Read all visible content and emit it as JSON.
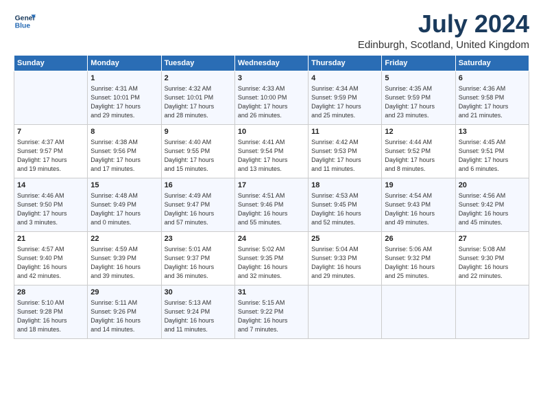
{
  "logo": {
    "line1": "General",
    "line2": "Blue"
  },
  "title": "July 2024",
  "subtitle": "Edinburgh, Scotland, United Kingdom",
  "days": [
    "Sunday",
    "Monday",
    "Tuesday",
    "Wednesday",
    "Thursday",
    "Friday",
    "Saturday"
  ],
  "rows": [
    [
      {
        "num": "",
        "lines": []
      },
      {
        "num": "1",
        "lines": [
          "Sunrise: 4:31 AM",
          "Sunset: 10:01 PM",
          "Daylight: 17 hours",
          "and 29 minutes."
        ]
      },
      {
        "num": "2",
        "lines": [
          "Sunrise: 4:32 AM",
          "Sunset: 10:01 PM",
          "Daylight: 17 hours",
          "and 28 minutes."
        ]
      },
      {
        "num": "3",
        "lines": [
          "Sunrise: 4:33 AM",
          "Sunset: 10:00 PM",
          "Daylight: 17 hours",
          "and 26 minutes."
        ]
      },
      {
        "num": "4",
        "lines": [
          "Sunrise: 4:34 AM",
          "Sunset: 9:59 PM",
          "Daylight: 17 hours",
          "and 25 minutes."
        ]
      },
      {
        "num": "5",
        "lines": [
          "Sunrise: 4:35 AM",
          "Sunset: 9:59 PM",
          "Daylight: 17 hours",
          "and 23 minutes."
        ]
      },
      {
        "num": "6",
        "lines": [
          "Sunrise: 4:36 AM",
          "Sunset: 9:58 PM",
          "Daylight: 17 hours",
          "and 21 minutes."
        ]
      }
    ],
    [
      {
        "num": "7",
        "lines": [
          "Sunrise: 4:37 AM",
          "Sunset: 9:57 PM",
          "Daylight: 17 hours",
          "and 19 minutes."
        ]
      },
      {
        "num": "8",
        "lines": [
          "Sunrise: 4:38 AM",
          "Sunset: 9:56 PM",
          "Daylight: 17 hours",
          "and 17 minutes."
        ]
      },
      {
        "num": "9",
        "lines": [
          "Sunrise: 4:40 AM",
          "Sunset: 9:55 PM",
          "Daylight: 17 hours",
          "and 15 minutes."
        ]
      },
      {
        "num": "10",
        "lines": [
          "Sunrise: 4:41 AM",
          "Sunset: 9:54 PM",
          "Daylight: 17 hours",
          "and 13 minutes."
        ]
      },
      {
        "num": "11",
        "lines": [
          "Sunrise: 4:42 AM",
          "Sunset: 9:53 PM",
          "Daylight: 17 hours",
          "and 11 minutes."
        ]
      },
      {
        "num": "12",
        "lines": [
          "Sunrise: 4:44 AM",
          "Sunset: 9:52 PM",
          "Daylight: 17 hours",
          "and 8 minutes."
        ]
      },
      {
        "num": "13",
        "lines": [
          "Sunrise: 4:45 AM",
          "Sunset: 9:51 PM",
          "Daylight: 17 hours",
          "and 6 minutes."
        ]
      }
    ],
    [
      {
        "num": "14",
        "lines": [
          "Sunrise: 4:46 AM",
          "Sunset: 9:50 PM",
          "Daylight: 17 hours",
          "and 3 minutes."
        ]
      },
      {
        "num": "15",
        "lines": [
          "Sunrise: 4:48 AM",
          "Sunset: 9:49 PM",
          "Daylight: 17 hours",
          "and 0 minutes."
        ]
      },
      {
        "num": "16",
        "lines": [
          "Sunrise: 4:49 AM",
          "Sunset: 9:47 PM",
          "Daylight: 16 hours",
          "and 57 minutes."
        ]
      },
      {
        "num": "17",
        "lines": [
          "Sunrise: 4:51 AM",
          "Sunset: 9:46 PM",
          "Daylight: 16 hours",
          "and 55 minutes."
        ]
      },
      {
        "num": "18",
        "lines": [
          "Sunrise: 4:53 AM",
          "Sunset: 9:45 PM",
          "Daylight: 16 hours",
          "and 52 minutes."
        ]
      },
      {
        "num": "19",
        "lines": [
          "Sunrise: 4:54 AM",
          "Sunset: 9:43 PM",
          "Daylight: 16 hours",
          "and 49 minutes."
        ]
      },
      {
        "num": "20",
        "lines": [
          "Sunrise: 4:56 AM",
          "Sunset: 9:42 PM",
          "Daylight: 16 hours",
          "and 45 minutes."
        ]
      }
    ],
    [
      {
        "num": "21",
        "lines": [
          "Sunrise: 4:57 AM",
          "Sunset: 9:40 PM",
          "Daylight: 16 hours",
          "and 42 minutes."
        ]
      },
      {
        "num": "22",
        "lines": [
          "Sunrise: 4:59 AM",
          "Sunset: 9:39 PM",
          "Daylight: 16 hours",
          "and 39 minutes."
        ]
      },
      {
        "num": "23",
        "lines": [
          "Sunrise: 5:01 AM",
          "Sunset: 9:37 PM",
          "Daylight: 16 hours",
          "and 36 minutes."
        ]
      },
      {
        "num": "24",
        "lines": [
          "Sunrise: 5:02 AM",
          "Sunset: 9:35 PM",
          "Daylight: 16 hours",
          "and 32 minutes."
        ]
      },
      {
        "num": "25",
        "lines": [
          "Sunrise: 5:04 AM",
          "Sunset: 9:33 PM",
          "Daylight: 16 hours",
          "and 29 minutes."
        ]
      },
      {
        "num": "26",
        "lines": [
          "Sunrise: 5:06 AM",
          "Sunset: 9:32 PM",
          "Daylight: 16 hours",
          "and 25 minutes."
        ]
      },
      {
        "num": "27",
        "lines": [
          "Sunrise: 5:08 AM",
          "Sunset: 9:30 PM",
          "Daylight: 16 hours",
          "and 22 minutes."
        ]
      }
    ],
    [
      {
        "num": "28",
        "lines": [
          "Sunrise: 5:10 AM",
          "Sunset: 9:28 PM",
          "Daylight: 16 hours",
          "and 18 minutes."
        ]
      },
      {
        "num": "29",
        "lines": [
          "Sunrise: 5:11 AM",
          "Sunset: 9:26 PM",
          "Daylight: 16 hours",
          "and 14 minutes."
        ]
      },
      {
        "num": "30",
        "lines": [
          "Sunrise: 5:13 AM",
          "Sunset: 9:24 PM",
          "Daylight: 16 hours",
          "and 11 minutes."
        ]
      },
      {
        "num": "31",
        "lines": [
          "Sunrise: 5:15 AM",
          "Sunset: 9:22 PM",
          "Daylight: 16 hours",
          "and 7 minutes."
        ]
      },
      {
        "num": "",
        "lines": []
      },
      {
        "num": "",
        "lines": []
      },
      {
        "num": "",
        "lines": []
      }
    ]
  ],
  "colors": {
    "header_bg": "#2a6db5",
    "title_color": "#1a3a5c"
  }
}
